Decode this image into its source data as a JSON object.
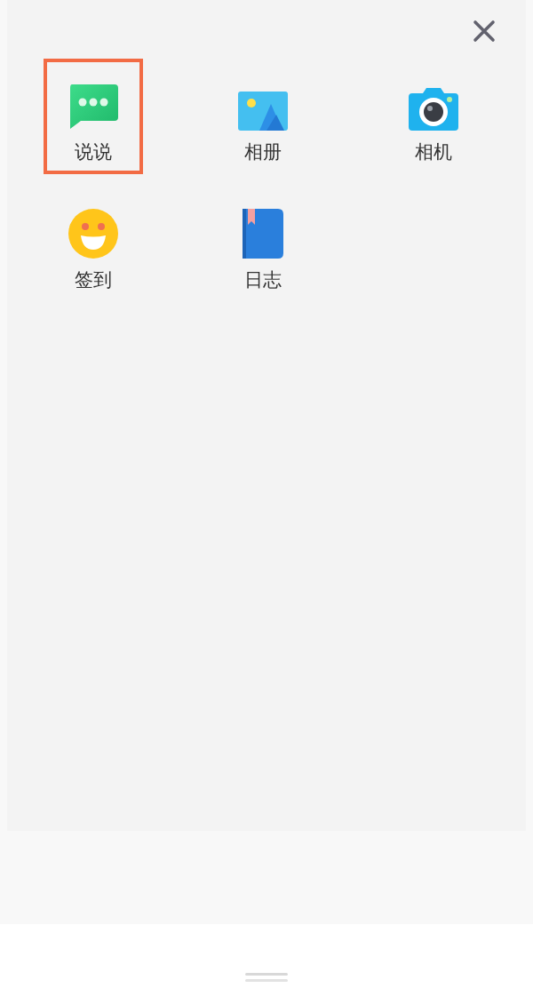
{
  "items": [
    {
      "kind": "chat",
      "label": "说说",
      "highlighted": true
    },
    {
      "kind": "album",
      "label": "相册",
      "highlighted": false
    },
    {
      "kind": "camera",
      "label": "相机",
      "highlighted": false
    },
    {
      "kind": "checkin",
      "label": "签到",
      "highlighted": false
    },
    {
      "kind": "diary",
      "label": "日志",
      "highlighted": false
    }
  ]
}
